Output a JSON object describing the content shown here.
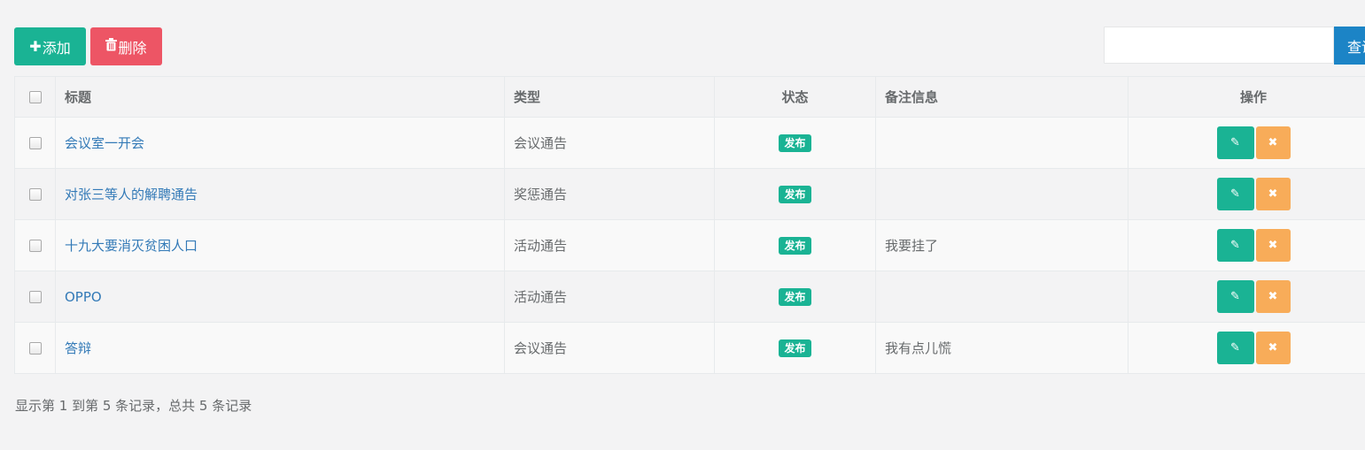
{
  "toolbar": {
    "add_icon": "+",
    "add_label": "添加",
    "delete_icon": "trash-icon",
    "delete_label": "删除",
    "search_placeholder": "",
    "search_button": "查询"
  },
  "colors": {
    "primary": "#1ab394",
    "danger": "#ed5565",
    "warning": "#f8ac59",
    "info": "#1c84c6",
    "link": "#337ab7"
  },
  "table": {
    "headers": {
      "title": "标题",
      "type": "类型",
      "status": "状态",
      "remark": "备注信息",
      "actions": "操作"
    },
    "rows": [
      {
        "title": "会议室一开会",
        "type": "会议通告",
        "status": "发布",
        "remark": ""
      },
      {
        "title": "对张三等人的解聘通告",
        "type": "奖惩通告",
        "status": "发布",
        "remark": ""
      },
      {
        "title": "十九大要消灭贫困人口",
        "type": "活动通告",
        "status": "发布",
        "remark": "我要挂了"
      },
      {
        "title": "OPPO",
        "type": "活动通告",
        "status": "发布",
        "remark": ""
      },
      {
        "title": "答辩",
        "type": "会议通告",
        "status": "发布",
        "remark": "我有点儿慌"
      }
    ]
  },
  "pagination": {
    "info": "显示第 1 到第 5 条记录，总共 5 条记录"
  }
}
